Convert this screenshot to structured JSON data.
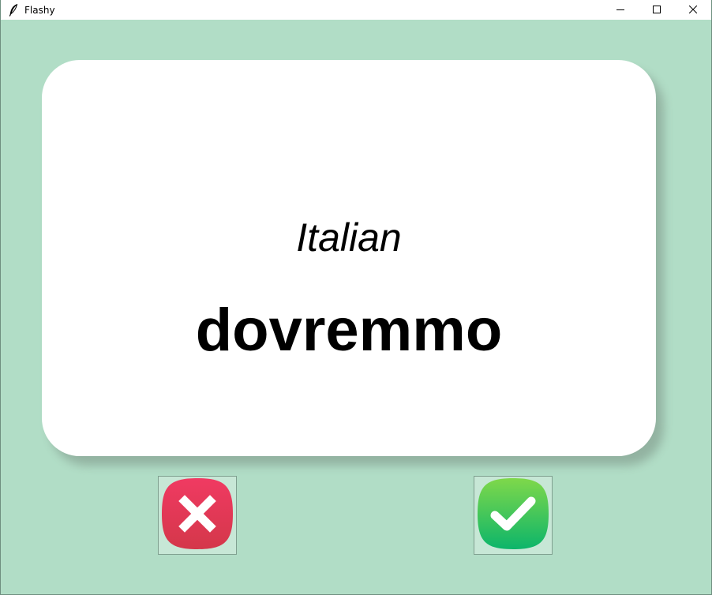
{
  "window": {
    "title": "Flashy",
    "icons": {
      "app": "feather-icon",
      "minimize": "minimize-icon",
      "maximize": "maximize-icon",
      "close": "close-icon"
    }
  },
  "card": {
    "language": "Italian",
    "word": "dovremmo"
  },
  "buttons": {
    "wrong": {
      "icon": "cross-icon",
      "color": "#e23a5a"
    },
    "right": {
      "icon": "checkmark-icon",
      "color": "#35c763"
    }
  },
  "colors": {
    "background": "#b1ddc6",
    "card": "#ffffff"
  }
}
